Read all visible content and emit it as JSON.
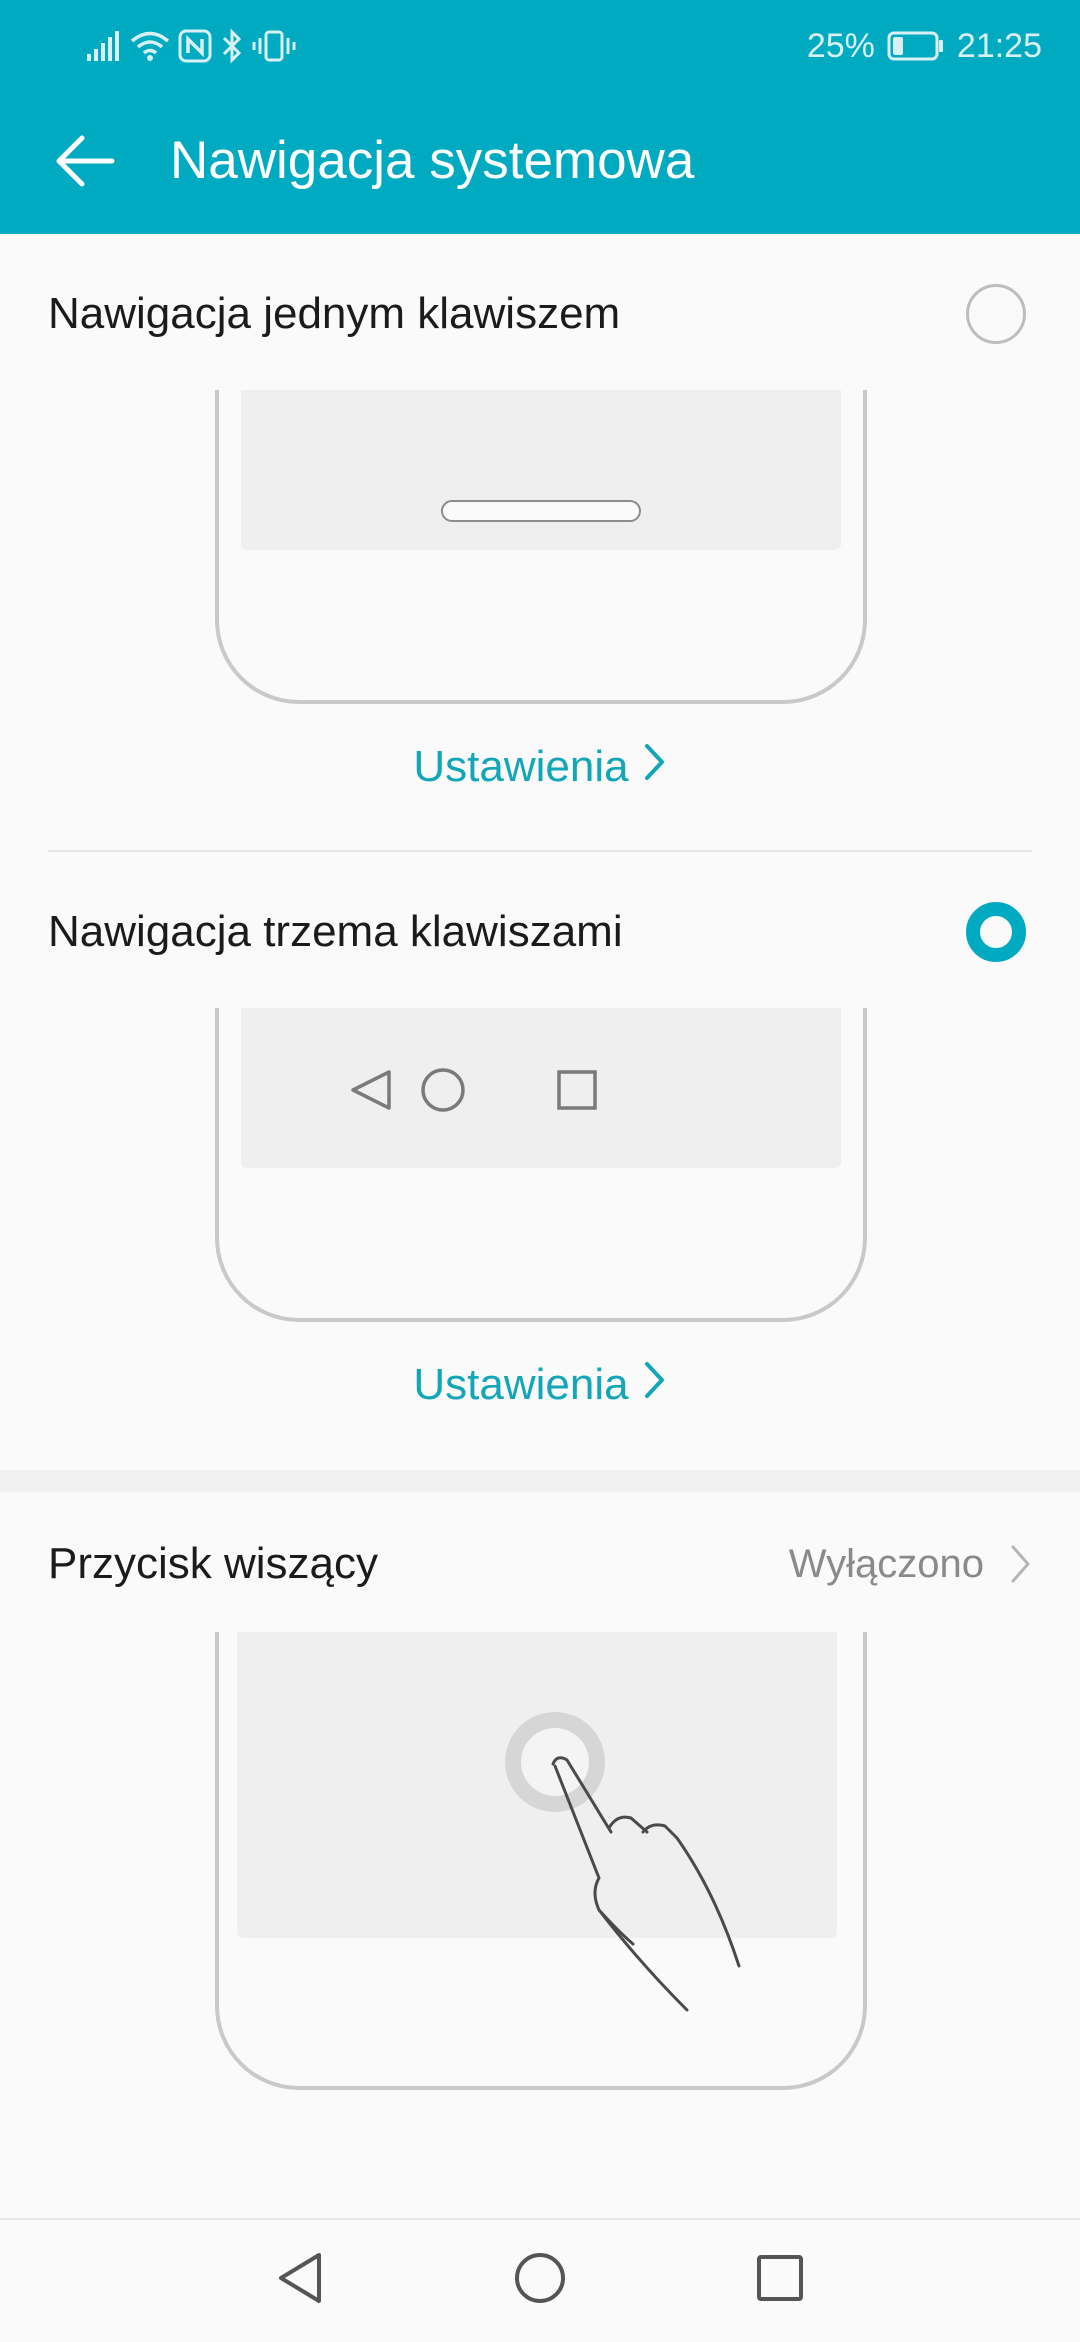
{
  "status_bar": {
    "battery_percent": "25%",
    "time": "21:25",
    "battery_level": 0.25,
    "icons": [
      "signal-icon",
      "wifi-icon",
      "nfc-icon",
      "bluetooth-icon",
      "vibrate-icon",
      "battery-icon"
    ]
  },
  "header": {
    "title": "Nawigacja systemowa",
    "back_icon": "back-arrow-icon",
    "background_color": "#00abc2"
  },
  "options": [
    {
      "label": "Nawigacja jednym klawiszem",
      "selected": false,
      "illustration": "single-key-pill",
      "settings_label": "Ustawienia"
    },
    {
      "label": "Nawigacja trzema klawiszami",
      "selected": true,
      "illustration": "three-keys",
      "settings_label": "Ustawienia"
    }
  ],
  "floating_button": {
    "label": "Przycisk wiszący",
    "value": "Wyłączono",
    "illustration": "finger-touch-dock"
  },
  "nav_bar": {
    "buttons": [
      "nav-back-icon",
      "nav-home-icon",
      "nav-recents-icon"
    ]
  },
  "colors": {
    "accent": "#00abc2",
    "link": "#13a6b8",
    "background": "#fafafa"
  }
}
